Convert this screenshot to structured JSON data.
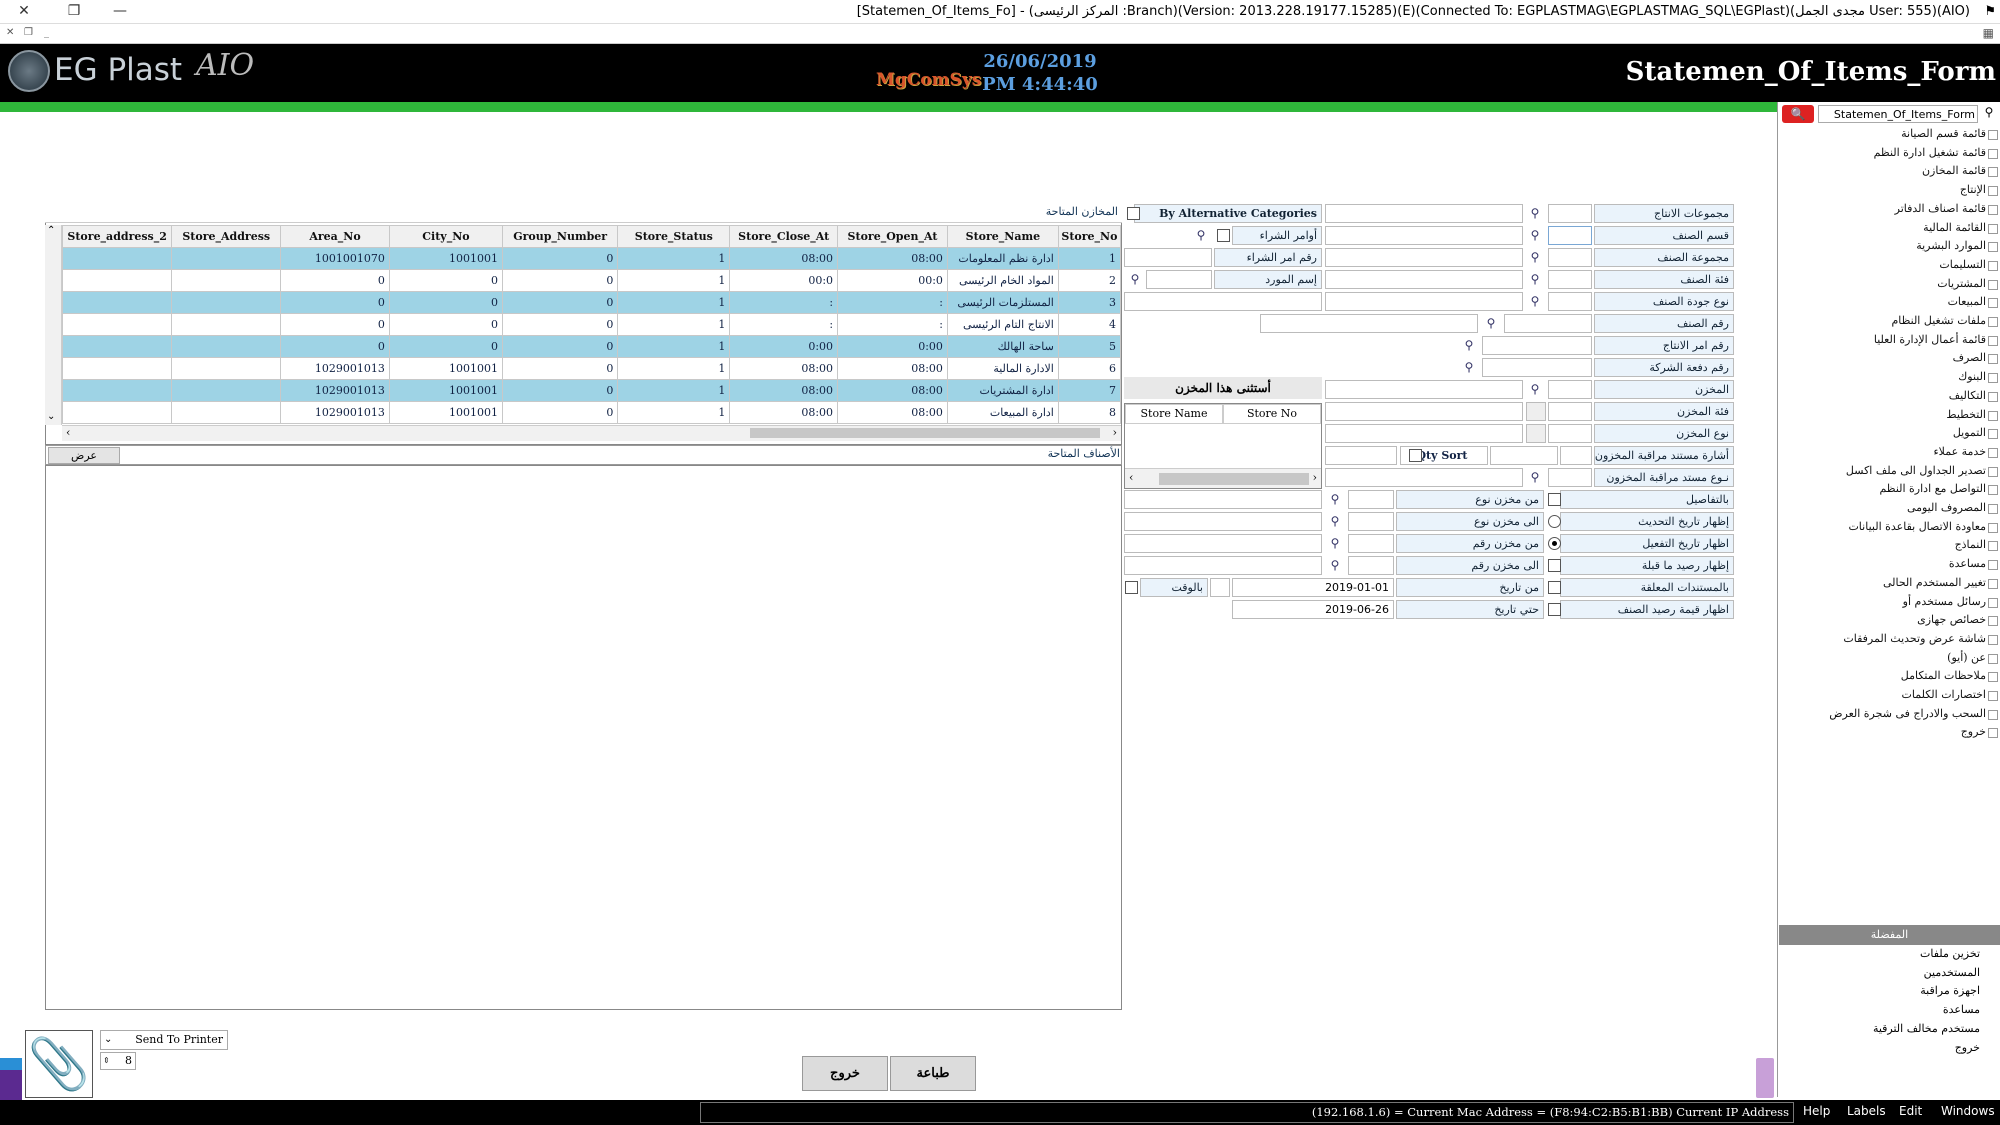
{
  "window": {
    "title": "[Statemen_Of_Items_Fo] - (المركز الرئيسى :Branch)(Version: 2013.228.19177.15285)(E)(Connected To: EGPLASTMAG\\EGPLASTMAG_SQL\\EGPlast)(مجدى الجمل User: 555)(AIO)",
    "close": "✕",
    "restore": "❐",
    "minimize": "—"
  },
  "header": {
    "logo": "EG Plast",
    "logo_suffix": "AIO",
    "brand": "MgComSys",
    "date": "26/06/2019",
    "time": "PM 4:44:40",
    "form_title": "Statemen_Of_Items_Form"
  },
  "nav": {
    "search_value": "Statemen_Of_Items_Form",
    "items": [
      "قائمة قسم الصيانة",
      "قائمة تشغيل ادارة النظم",
      "قائمة المخازن",
      "الإنتاج",
      "قائمة اصناف الدفاتر",
      "القائمة المالية",
      "الموارد البشرية",
      "التسليمات",
      "المشتريات",
      "المبيعات",
      "ملفات تشغيل النظام",
      "قائمة أعمال الإدارة العليا",
      "الصرف",
      "البنوك",
      "التكاليف",
      "التخطيط",
      "التمويل",
      "خدمة عملاء",
      "تصدير الجداول الى ملف اكسل",
      "التواصل مع ادارة النظم",
      "المصروف اليومى",
      "معاودة الاتصال بقاعدة البيانات",
      "النماذج",
      "مساعدة",
      "تغيير المستخدم الحالى",
      "رسائل مستخدم أو",
      "خصائص جهازى",
      "شاشة عرض وتحديث المرفقات",
      "عن (أيو)",
      "ملاحظات المتكامل",
      "اختصارات الكلمات",
      "السحب والادراج فى شجرة العرض",
      "خروج"
    ],
    "section_title": "المفضلة",
    "fav_items": [
      "تخزين ملفات",
      "المستخدمين",
      "اجهزة مراقبة",
      "مساعدة",
      "مستخدم مخالف الترقية",
      "خروج"
    ]
  },
  "grid": {
    "caption": "المخازن المتاحة",
    "columns": [
      "Store_No",
      "Store_Name",
      "Store_Open_At",
      "Store_Close_At",
      "Store_Status",
      "Group_Number",
      "City_No",
      "Area_No",
      "Store_Address",
      "Store_address_2"
    ],
    "rows": [
      [
        "1",
        "ادارة نظم المعلومات",
        "08:00",
        "08:00",
        "1",
        "0",
        "1001001",
        "1001001070",
        "",
        ""
      ],
      [
        "2",
        "المواد الخام الرئيسى",
        "00:0",
        "00:0",
        "1",
        "0",
        "0",
        "0",
        "",
        ""
      ],
      [
        "3",
        "المستلزمات الرئيسى",
        ":",
        ":",
        "1",
        "0",
        "0",
        "0",
        "",
        ""
      ],
      [
        "4",
        "الانتاج التام الرئيسى",
        ":",
        ":",
        "1",
        "0",
        "0",
        "0",
        "",
        ""
      ],
      [
        "5",
        "ساحة الهالك",
        "0:00",
        "0:00",
        "1",
        "0",
        "0",
        "0",
        "",
        ""
      ],
      [
        "6",
        "الادارة المالية",
        "08:00",
        "08:00",
        "1",
        "0",
        "1001001",
        "1029001013",
        "",
        ""
      ],
      [
        "7",
        "ادارة المشتريات",
        "08:00",
        "08:00",
        "1",
        "0",
        "1001001",
        "1029001013",
        "",
        ""
      ],
      [
        "8",
        "ادارة المبيعات",
        "08:00",
        "08:00",
        "1",
        "0",
        "1001001",
        "1029001013",
        "",
        ""
      ]
    ]
  },
  "avail_items": {
    "caption": "الأصناف المتاحة",
    "show_button": "عرض"
  },
  "form": {
    "prod_groups": "مجموعات الانتاج",
    "item_section": "قسم الصنف",
    "item_group": "مجموعة الصنف",
    "item_class": "فئة الصنف",
    "item_quality": "نوع جودة الصنف",
    "item_no": "رقم الصنف",
    "prod_order_no": "رقم امر الانتاج",
    "company_batch": "رقم دفعة الشركة",
    "store": "المخزن",
    "store_class": "فئة المخزن",
    "store_type": "نوع المخزن",
    "doc_ref": "أشارة مستند مراقبة المخزون",
    "doc_type": "نـوع مستد مراقبة المخزون",
    "by_alt_cat": "By Alternative Categories",
    "purchase_orders": "أوامر الشراء",
    "purchase_order_no": "رقم امر الشراء",
    "supplier_name": "إسم المورد",
    "except_store": "أستثنى هذا المخزن",
    "store_name_col": "Store Name",
    "store_no_col": "Store No",
    "qty_sort": "Qty Sort",
    "details": "بالتفاصيل",
    "show_update_date": "إظهار تاريخ التحديث",
    "show_run_date": "اظهار تاريخ التفعيل",
    "show_prev_balance": "إظهار رصيد ما قبلة",
    "pending_docs": "بالمستندات المعلقة",
    "show_item_value": "اظهار قيمة رصيد الصنف",
    "from_store_type": "من مخزن نوع",
    "to_store_type": "الى مخزن نوع",
    "from_store_no": "من مخزن رقم",
    "to_store_no": "الى مخزن رقم",
    "from_date": "من تاريخ",
    "to_date": "حتي تاريخ",
    "from_date_value": "2019-01-01",
    "to_date_value": "2019-06-26",
    "by_time": "بالوقت"
  },
  "bottom": {
    "printer": "Send To Printer",
    "copies": "8",
    "print_button": "طباعة",
    "exit_button": "خروج"
  },
  "status": {
    "ip_info": "(192.168.1.6) = Current Mac Address = (F8:94:C2:B5:B1:BB) Current IP Address",
    "menu": [
      "Help",
      "Labels",
      "Edit",
      "Windows"
    ]
  }
}
